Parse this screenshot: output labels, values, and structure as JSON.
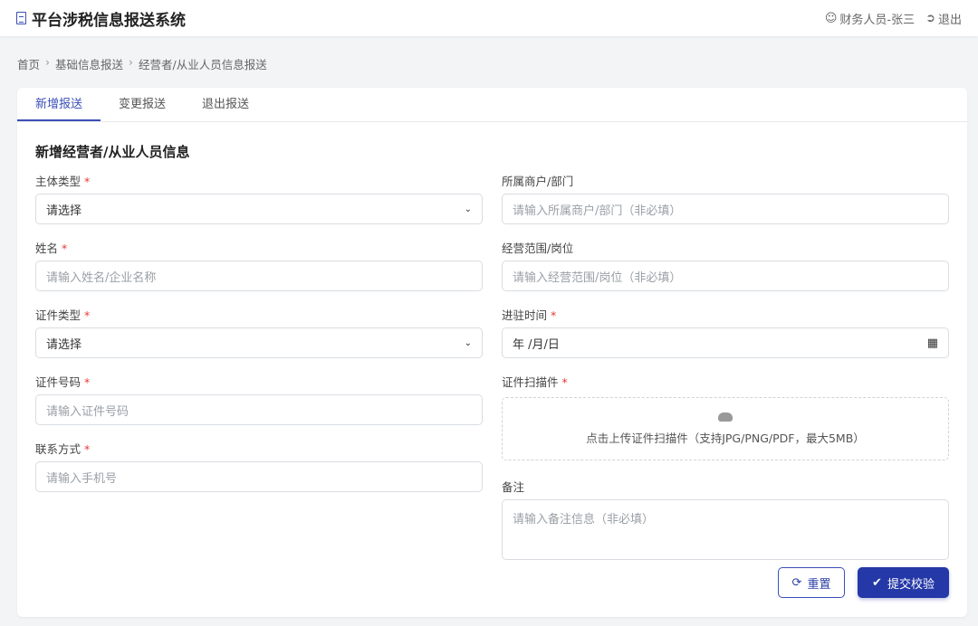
{
  "header": {
    "title": "平台涉税信息报送系统",
    "user": "财务人员-张三",
    "logout": "退出"
  },
  "breadcrumb": [
    "首页",
    "基础信息报送",
    "经营者/从业人员信息报送"
  ],
  "tabs": [
    {
      "label": "新增报送",
      "active": true
    },
    {
      "label": "变更报送"
    },
    {
      "label": "退出报送"
    }
  ],
  "form": {
    "title": "新增经营者/从业人员信息",
    "required_mark": "*",
    "subject_type": {
      "label": "主体类型",
      "value": "请选择"
    },
    "name": {
      "label": "姓名",
      "placeholder": "请输入姓名/企业名称"
    },
    "id_type": {
      "label": "证件类型",
      "value": "请选择"
    },
    "id_number": {
      "label": "证件号码",
      "placeholder": "请输入证件号码"
    },
    "contact": {
      "label": "联系方式",
      "placeholder": "请输入手机号"
    },
    "merchant": {
      "label": "所属商户/部门",
      "placeholder": "请输入所属商户/部门（非必填）"
    },
    "scope": {
      "label": "经营范围/岗位",
      "placeholder": "请输入经营范围/岗位（非必填）"
    },
    "entry_date": {
      "label": "进驻时间",
      "value": "年 /月/日"
    },
    "scan": {
      "label": "证件扫描件",
      "hint": "点击上传证件扫描件（支持JPG/PNG/PDF，最大5MB）"
    },
    "remark": {
      "label": "备注",
      "placeholder": "请输入备注信息（非必填）"
    }
  },
  "buttons": {
    "reset": "重置",
    "submit": "提交校验"
  }
}
